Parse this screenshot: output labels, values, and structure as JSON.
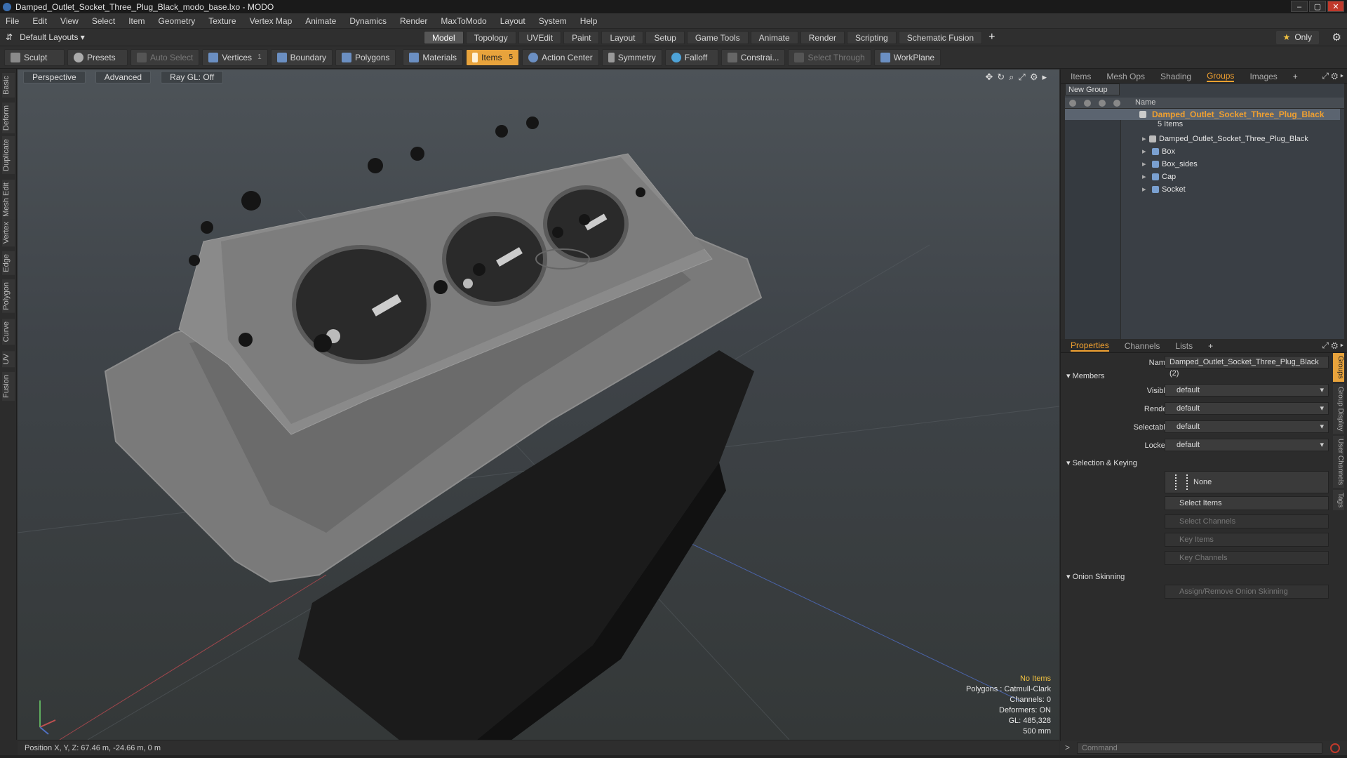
{
  "window": {
    "title": "Damped_Outlet_Socket_Three_Plug_Black_modo_base.lxo - MODO",
    "controls": [
      "–",
      "▢",
      "✕"
    ]
  },
  "menu": [
    "File",
    "Edit",
    "View",
    "Select",
    "Item",
    "Geometry",
    "Texture",
    "Vertex Map",
    "Animate",
    "Dynamics",
    "Render",
    "MaxToModo",
    "Layout",
    "System",
    "Help"
  ],
  "layout_bar": {
    "layouts_label": "Default Layouts ▾",
    "tabs": [
      "Model",
      "Topology",
      "UVEdit",
      "Paint",
      "Layout",
      "Setup",
      "Game Tools",
      "Animate",
      "Render",
      "Scripting",
      "Schematic Fusion"
    ],
    "active_tab": "Model",
    "add": "+",
    "only_star": "★",
    "only_label": "Only"
  },
  "toolbar": {
    "sculpt": "Sculpt",
    "presets": "Presets",
    "auto_select": "Auto Select",
    "vertices": "Vertices",
    "vertices_count": "1",
    "boundary": "Boundary",
    "polygons": "Polygons",
    "materials": "Materials",
    "items": "Items",
    "items_count": "5",
    "action_center": "Action Center",
    "symmetry": "Symmetry",
    "falloff": "Falloff",
    "constrain": "Constrai...",
    "select_through": "Select Through",
    "workplane": "WorkPlane"
  },
  "left_tabs": [
    "Basic",
    "Deform",
    "Duplicate",
    "Mesh Edit",
    "Vertex",
    "Edge",
    "Polygon",
    "Curve",
    "UV",
    "Fusion"
  ],
  "viewport": {
    "perspective": "Perspective",
    "advanced": "Advanced",
    "raygl": "Ray GL: Off",
    "hud": {
      "no_items": "No Items",
      "polygons": "Polygons : Catmull-Clark",
      "channels": "Channels: 0",
      "deformers": "Deformers: ON",
      "gl": "GL: 485,328",
      "scale": "500 mm"
    }
  },
  "status": {
    "position": "Position X, Y, Z:  67.46 m, -24.66 m, 0 m"
  },
  "top_panel": {
    "tabs": [
      "Items",
      "Mesh Ops",
      "Shading",
      "Groups",
      "Images"
    ],
    "active": "Groups",
    "add": "+",
    "new_group": "New Group",
    "col_name": "Name",
    "group_name": "Damped_Outlet_Socket_Three_Plug_Black",
    "group_count": "5 Items",
    "members": [
      "Damped_Outlet_Socket_Three_Plug_Black",
      "Box",
      "Box_sides",
      "Cap",
      "Socket"
    ]
  },
  "bottom_panel": {
    "tabs": [
      "Properties",
      "Channels",
      "Lists"
    ],
    "active": "Properties",
    "add": "+",
    "name_label": "Name",
    "name_value": "Damped_Outlet_Socket_Three_Plug_Black (2)",
    "members_section": "Members",
    "visible_label": "Visible",
    "visible_value": "default",
    "render_label": "Render",
    "render_value": "default",
    "selectable_label": "Selectable",
    "selectable_value": "default",
    "locked_label": "Locked",
    "locked_value": "default",
    "selkey_section": "Selection & Keying",
    "none_btn": "None",
    "select_items": "Select Items",
    "select_channels": "Select Channels",
    "key_items": "Key Items",
    "key_channels": "Key Channels",
    "onion_section": "Onion Skinning",
    "onion_btn": "Assign/Remove Onion Skinning",
    "side_tabs": [
      "Groups",
      "Group Display",
      "User Channels",
      "Tags"
    ]
  },
  "command": {
    "placeholder": "Command",
    "prompt": ">"
  },
  "colors": {
    "accent": "#f0a030",
    "viewport_bg": "#454a4f",
    "panel_bg": "#2c2c2c"
  }
}
